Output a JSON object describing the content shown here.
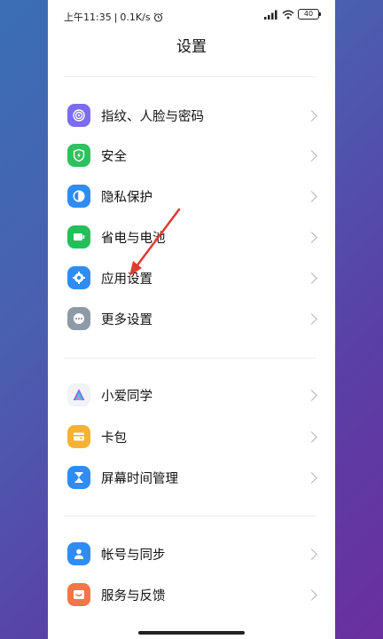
{
  "status_bar": {
    "time": "上午11:35",
    "separator": "|",
    "net_speed": "0.1K/s",
    "battery": "40"
  },
  "page": {
    "title": "设置"
  },
  "groups": [
    {
      "items": [
        {
          "label": "指纹、人脸与密码",
          "icon": "fingerprint-icon",
          "color": "#7b6cf0"
        },
        {
          "label": "安全",
          "icon": "shield-bolt-icon",
          "color": "#2dc15f"
        },
        {
          "label": "隐私保护",
          "icon": "privacy-icon",
          "color": "#2f8cf2"
        },
        {
          "label": "省电与电池",
          "icon": "battery-icon",
          "color": "#23bf5a"
        },
        {
          "label": "应用设置",
          "icon": "gear-icon",
          "color": "#2f8cf2"
        },
        {
          "label": "更多设置",
          "icon": "more-dots-icon",
          "color": "#8f9aa8"
        }
      ]
    },
    {
      "items": [
        {
          "label": "小爱同学",
          "icon": "xiaoai-icon",
          "color": "#f2f3f7"
        },
        {
          "label": "卡包",
          "icon": "wallet-icon",
          "color": "#f5b234"
        },
        {
          "label": "屏幕时间管理",
          "icon": "hourglass-icon",
          "color": "#2f8cf2"
        }
      ]
    },
    {
      "items": [
        {
          "label": "帐号与同步",
          "icon": "account-icon",
          "color": "#2f8cf2"
        },
        {
          "label": "服务与反馈",
          "icon": "feedback-icon",
          "color": "#f5744a"
        }
      ]
    }
  ],
  "colors": {
    "annotation_arrow": "#e23a2e"
  }
}
